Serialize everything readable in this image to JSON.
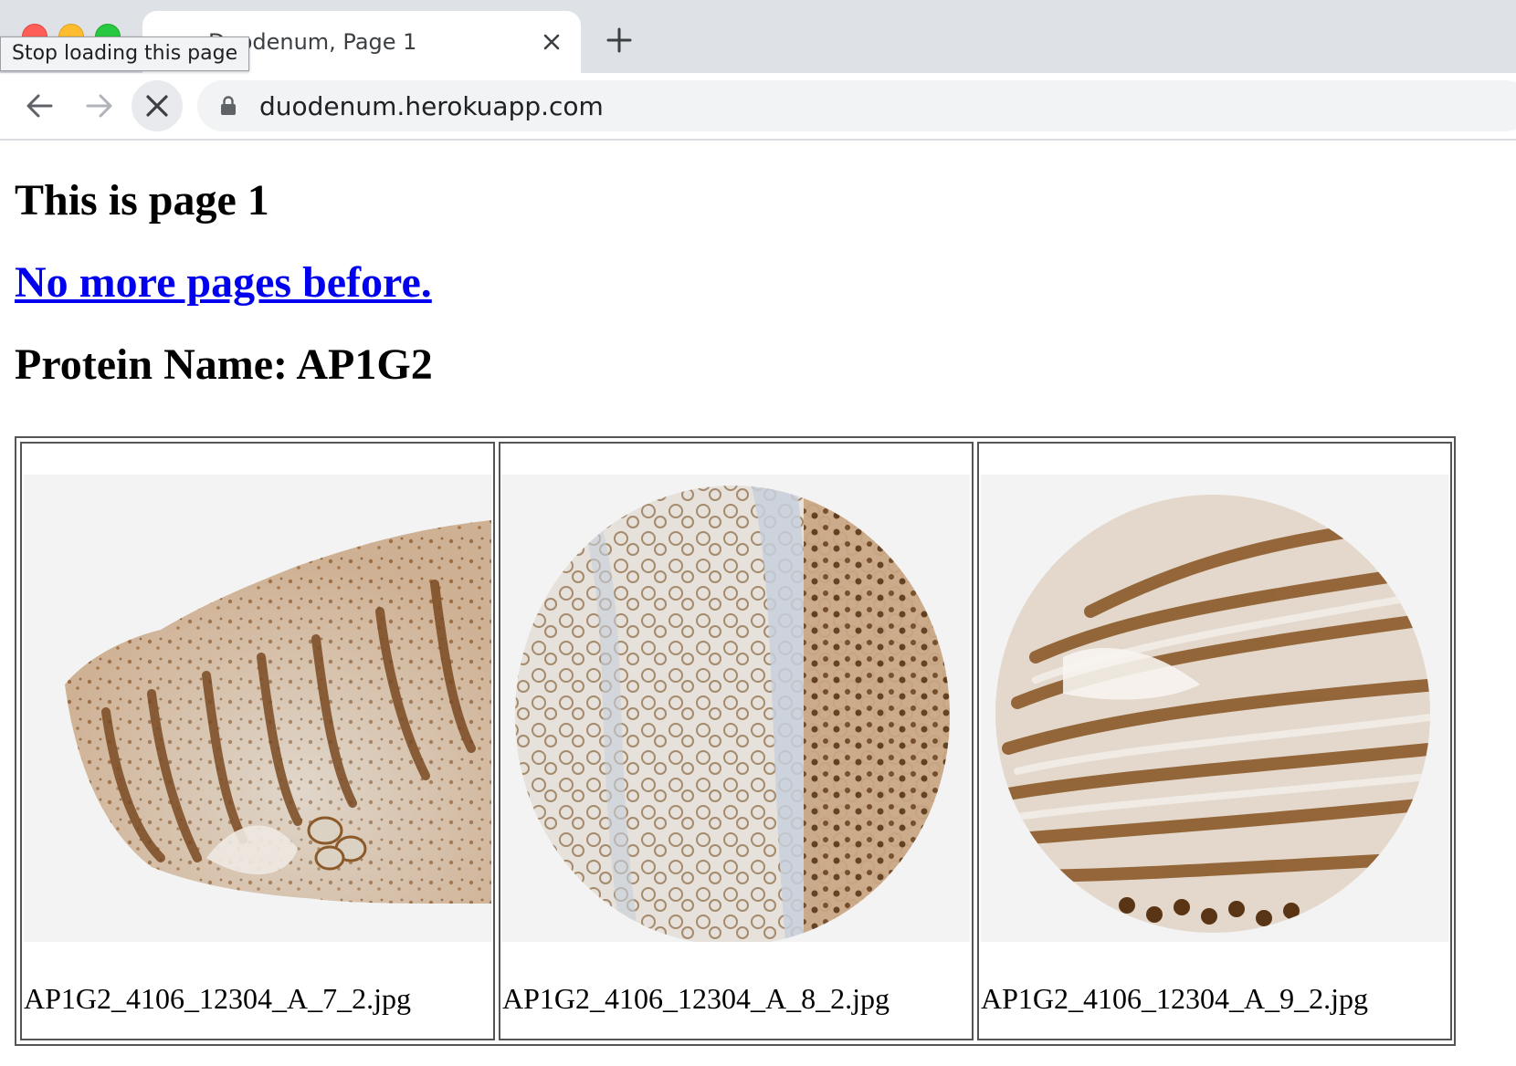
{
  "browser": {
    "tab_title": "Duodenum, Page 1",
    "tooltip": "Stop loading this page",
    "url": "duodenum.herokuapp.com",
    "icons": {
      "close_tab": "close-icon",
      "new_tab": "plus-icon",
      "back": "arrow-left-icon",
      "forward": "arrow-right-icon",
      "stop": "stop-loading-icon",
      "security": "lock-icon"
    }
  },
  "page": {
    "heading": "This is page 1",
    "prev_link": "No more pages before.",
    "protein_heading": "Protein Name: AP1G2",
    "images": [
      {
        "caption": "AP1G2_4106_12304_A_7_2.jpg"
      },
      {
        "caption": "AP1G2_4106_12304_A_8_2.jpg"
      },
      {
        "caption": "AP1G2_4106_12304_A_9_2.jpg"
      }
    ]
  },
  "colors": {
    "link": "#0000ee",
    "tabstrip": "#dee1e6",
    "stain_brown": "#8b5a2b",
    "stain_blue": "#b8c4d6"
  }
}
